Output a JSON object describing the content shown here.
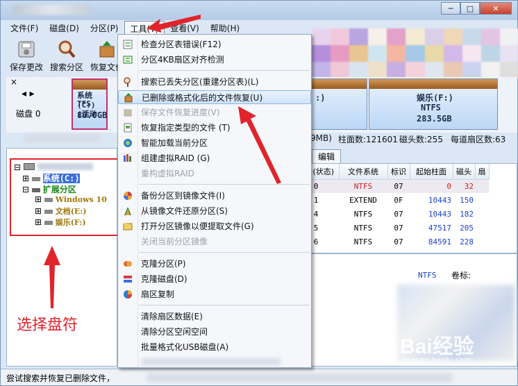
{
  "menubar": [
    "文件(F)",
    "磁盘(D)",
    "分区(P)",
    "工具(T)",
    "查看(V)",
    "帮助(H)"
  ],
  "toolbar": [
    {
      "label": "保存更改",
      "icon": "disk-save-icon"
    },
    {
      "label": "搜索分区",
      "icon": "magnifier-icon"
    },
    {
      "label": "恢复文件",
      "icon": "recover-box-icon"
    }
  ],
  "disk": {
    "label": "磁盘 0",
    "part_system_line1": "系统(C:)",
    "part_system_line2": "TFS (活动",
    "part_system_size": "80.0GB",
    "part_mid_letter": ":)",
    "part_ent_name": "娱乐(F:)",
    "part_ent_fs": "NTFS",
    "part_ent_size": "283.5GB"
  },
  "info": {
    "left": "9MB)",
    "cyl": "柱面数:121601",
    "heads": "磁头数:255",
    "sectors": "每道扇区数:63"
  },
  "tab_label": "编辑",
  "tree": {
    "root": "",
    "system": "系统(C:)",
    "extended": "扩展分区",
    "win10": "Windows 10",
    "docs": "文档(E:)",
    "ent": "娱乐(F:)"
  },
  "annotation_text": "选择盘符",
  "grid": {
    "headers": [
      "序号(状态)",
      "文件系统",
      "标识",
      "起始柱面",
      "磁头",
      "扇"
    ],
    "rows": [
      {
        "idx": "0",
        "fs": "NTFS",
        "id": "07",
        "start": "0",
        "head": "32"
      },
      {
        "idx": "1",
        "fs": "EXTEND",
        "id": "0F",
        "start": "10443",
        "head": "150"
      },
      {
        "idx": "4",
        "fs": "NTFS",
        "id": "07",
        "start": "10443",
        "head": "182"
      },
      {
        "idx": "5",
        "fs": "NTFS",
        "id": "07",
        "start": "47517",
        "head": "205"
      },
      {
        "idx": "6",
        "fs": "NTFS",
        "id": "07",
        "start": "84591",
        "head": "228"
      }
    ]
  },
  "lower_panel": {
    "fs": "NTFS",
    "volume_label": "卷标:"
  },
  "status_text": "尝试搜索并恢复已删除文件，",
  "watermark": {
    "main": "Bai经验",
    "sub": "jingyan.baidu.com"
  },
  "dropdown": [
    {
      "label": "检查分区表错误(F12)",
      "icon": "check-table-icon",
      "disabled": false
    },
    {
      "label": "分区4KB扇区对齐检测",
      "icon": "align-icon",
      "disabled": false
    },
    {
      "sep": true
    },
    {
      "label": "搜索已丢失分区(重建分区表)(L)",
      "icon": "search-lost-icon",
      "disabled": false
    },
    {
      "label": "已删除或格式化后的文件恢复(U)",
      "icon": "file-recover-icon",
      "disabled": false,
      "hover": true
    },
    {
      "label": "保存文件恢复进度(V)",
      "icon": "save-progress-icon",
      "disabled": true
    },
    {
      "label": "恢复指定类型的文件 (T)",
      "icon": "file-type-icon",
      "disabled": false
    },
    {
      "label": "智能加载当前分区",
      "icon": "smart-load-icon",
      "disabled": false
    },
    {
      "label": "组建虚拟RAID (G)",
      "icon": "raid-icon",
      "disabled": false
    },
    {
      "label": "重构虚拟RAID",
      "icon": "",
      "disabled": true
    },
    {
      "sep": true
    },
    {
      "label": "备份分区到镜像文件(I)",
      "icon": "backup-image-icon",
      "disabled": false
    },
    {
      "label": "从镜像文件还原分区(S)",
      "icon": "restore-image-icon",
      "disabled": false
    },
    {
      "label": "打开分区镜像以便提取文件(G)",
      "icon": "open-image-icon",
      "disabled": false
    },
    {
      "label": "关闭当前分区镜像",
      "icon": "",
      "disabled": true
    },
    {
      "sep": true
    },
    {
      "label": "克隆分区(P)",
      "icon": "clone-partition-icon",
      "disabled": false
    },
    {
      "label": "克隆磁盘(D)",
      "icon": "clone-disk-icon",
      "disabled": false
    },
    {
      "label": "扇区复制",
      "icon": "sector-copy-icon",
      "disabled": false
    },
    {
      "sep": true
    },
    {
      "label": "清除扇区数据(E)",
      "icon": "",
      "disabled": false
    },
    {
      "label": "清除分区空闲空间",
      "icon": "",
      "disabled": false
    },
    {
      "label": "批量格式化USB磁盘(A)",
      "icon": "",
      "disabled": false
    }
  ],
  "colors": {
    "annotation_red": "#e0242b",
    "accent_blue": "#1652d4",
    "menu_hover": "#cfe3f9"
  }
}
